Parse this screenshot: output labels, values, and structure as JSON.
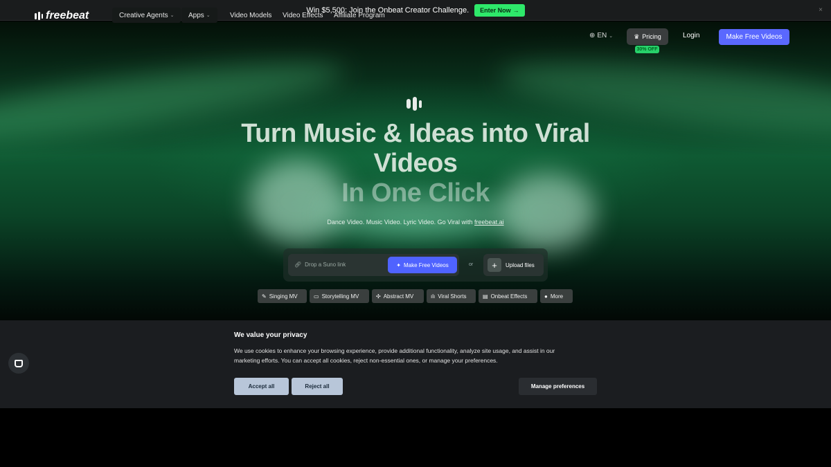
{
  "promo": {
    "text": "Win $5,500: Join the Onbeat Creator Challenge.",
    "button": "Enter Now",
    "button_arrow": "→",
    "close": "×"
  },
  "nav": {
    "logo": "freebeat",
    "items": [
      {
        "label": "Creative Agents",
        "has_dropdown": true
      },
      {
        "label": "Apps",
        "has_dropdown": true
      },
      {
        "label": "Video Models",
        "has_dropdown": false
      },
      {
        "label": "Video Effects",
        "has_dropdown": false
      },
      {
        "label": "Affiliate Program",
        "has_dropdown": false
      }
    ],
    "lang": "EN",
    "pricing": "Pricing",
    "pricing_badge": "30% OFF",
    "login": "Login",
    "cta": "Make Free Videos"
  },
  "hero": {
    "line1": "Turn Music & Ideas into Viral",
    "line2": "Videos",
    "line3": "In One Click",
    "subline": "Dance Video. Music Video. Lyric Video. Go Viral with",
    "subline_link": "freebeat.ai",
    "input_placeholder": "Drop a Suno link",
    "generate_button": "Make Free Videos",
    "or": "or",
    "upload": "Upload files",
    "chips": [
      {
        "label": "Singing MV",
        "icon": "mic-icon"
      },
      {
        "label": "Storytelling MV",
        "icon": "video-icon"
      },
      {
        "label": "Abstract MV",
        "icon": "sparkle-icon"
      },
      {
        "label": "Viral Shorts",
        "icon": "bars-icon"
      },
      {
        "label": "Onbeat Effects",
        "icon": "film-icon"
      },
      {
        "label": "More",
        "icon": "more-icon"
      }
    ]
  },
  "cookie": {
    "title": "We value your privacy",
    "body": "We use cookies to enhance your browsing experience, provide additional functionality, analyze site usage, and assist in our marketing efforts. You can accept all cookies, reject non-essential ones, or manage your preferences.",
    "accept": "Accept all",
    "reject": "Reject all",
    "manage": "Manage preferences"
  },
  "colors": {
    "accent": "#5a68ff",
    "promo_green": "#2ee86a",
    "hero_green": "#0f5a33"
  }
}
